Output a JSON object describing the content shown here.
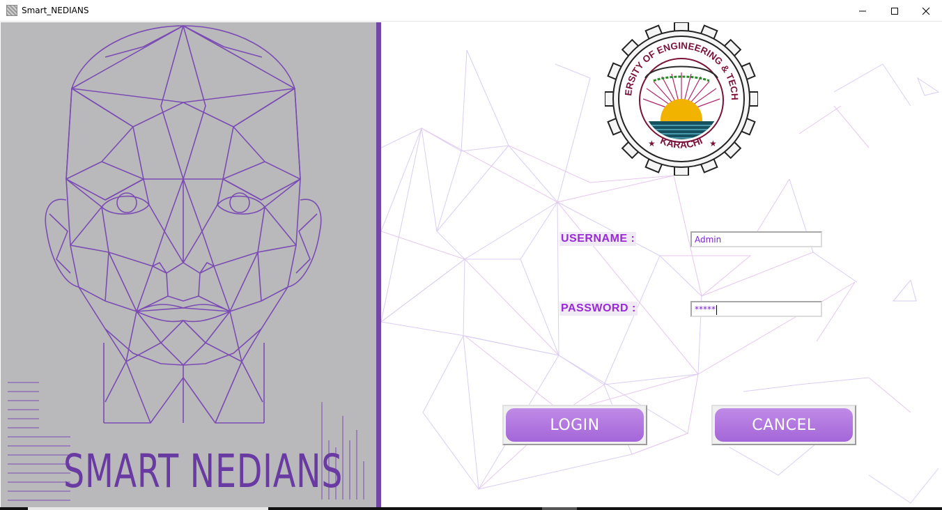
{
  "window": {
    "title": "Smart_NEDIANS",
    "minimize_icon": "minimize-icon",
    "maximize_icon": "maximize-icon",
    "close_icon": "close-icon"
  },
  "left_panel": {
    "brand_text": "SMART NEDIANS",
    "illustration": "low-poly-face-icon"
  },
  "logo": {
    "top_text": "NED UNIVERSITY OF ENGINEERING & TECHNOLOGY",
    "bottom_text": "KARACHI"
  },
  "form": {
    "username_label": "USERNAME :",
    "username_value": "Admin",
    "password_label": "PASSWORD :",
    "password_value": "*****"
  },
  "buttons": {
    "login_label": "LOGIN",
    "cancel_label": "CANCEL"
  },
  "colors": {
    "accent": "#7346a8",
    "label": "#9a2ad6",
    "button": "#b77ee2",
    "left_bg": "#b9b9bb"
  }
}
